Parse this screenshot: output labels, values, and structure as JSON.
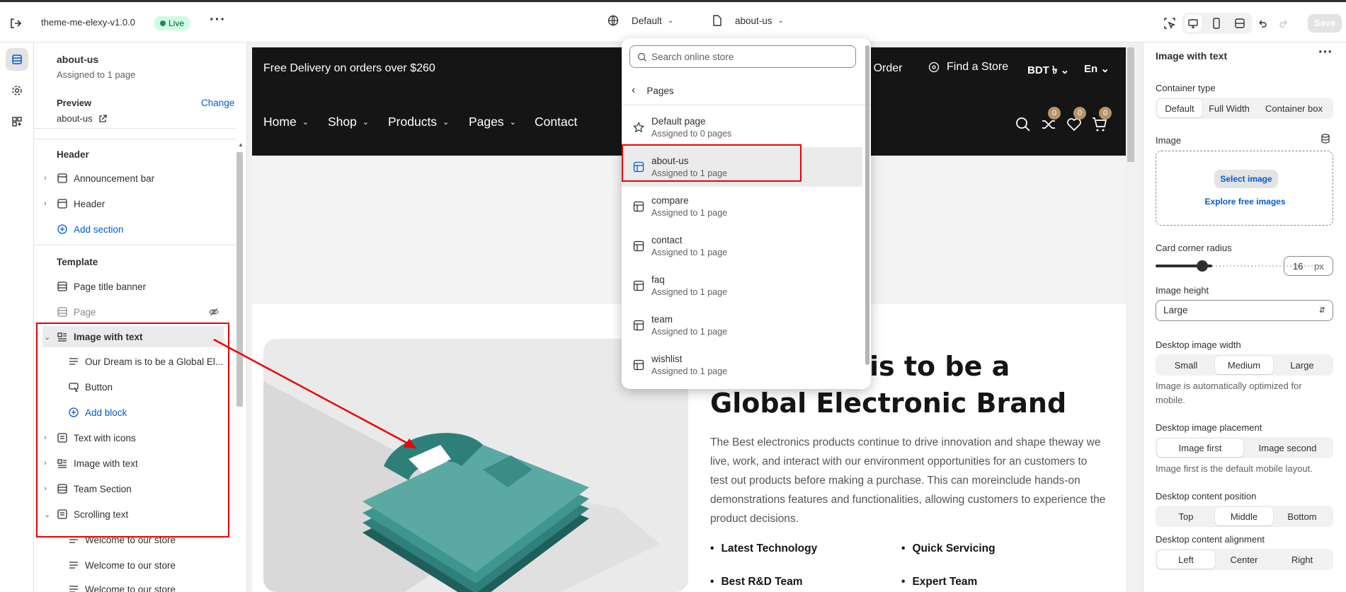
{
  "topbar": {
    "theme_name": "theme-me-elexy-v1.0.0",
    "status_badge": "Live",
    "template_select": "Default",
    "page_select": "about-us",
    "save_label": "Save"
  },
  "left_panel": {
    "page_title": "about-us",
    "page_assigned": "Assigned to 1 page",
    "preview_label": "Preview",
    "change_label": "Change",
    "preview_value": "about-us",
    "header_section": {
      "title": "Header",
      "items": [
        "Announcement bar",
        "Header"
      ],
      "add_section": "Add section"
    },
    "template_section": {
      "title": "Template",
      "items": [
        "Page title banner",
        "Page",
        "Image with text",
        "Our Dream is to be a Global El...",
        "Button",
        "Add block",
        "Text with icons",
        "Image with text",
        "Team Section",
        "Scrolling text",
        "Welcome to our store",
        "Welcome to our store",
        "Welcome to our store"
      ]
    }
  },
  "canvas": {
    "announcement": "Free Delivery on orders over $260",
    "ann_links": [
      "our Order",
      "Find a Store"
    ],
    "currency": "BDT ৳",
    "language": "En",
    "nav": [
      "Home",
      "Shop",
      "Products",
      "Pages",
      "Contact"
    ],
    "badges": [
      "0",
      "0",
      "0"
    ],
    "heading_line1": "is to be a",
    "heading_line2": "Global Electronic Brand",
    "body": "The Best electronics products continue to drive innovation and shape theway we live, work, and interact with our environment opportunities for an customers to test out products before making a purchase. This can moreinclude hands-on demonstrations features and functionalities, allowing customers to experience the product decisions.",
    "bullets": [
      "Latest Technology",
      "Quick Servicing",
      "Best R&D Team",
      "Expert Team"
    ]
  },
  "dropdown": {
    "search_placeholder": "Search online store",
    "back_label": "Pages",
    "items": [
      {
        "name": "Default page",
        "sub": "Assigned to 0 pages"
      },
      {
        "name": "about-us",
        "sub": "Assigned to 1 page"
      },
      {
        "name": "compare",
        "sub": "Assigned to 1 page"
      },
      {
        "name": "contact",
        "sub": "Assigned to 1 page"
      },
      {
        "name": "faq",
        "sub": "Assigned to 1 page"
      },
      {
        "name": "team",
        "sub": "Assigned to 1 page"
      },
      {
        "name": "wishlist",
        "sub": "Assigned to 1 page"
      }
    ]
  },
  "right_panel": {
    "title": "Image with text",
    "container_type_label": "Container type",
    "container_options": [
      "Default",
      "Full Width",
      "Container box"
    ],
    "image_label": "Image",
    "select_image": "Select image",
    "explore_images": "Explore free images",
    "corner_radius_label": "Card corner radius",
    "corner_radius_value": "16",
    "corner_radius_unit": "px",
    "image_height_label": "Image height",
    "image_height_value": "Large",
    "desktop_width_label": "Desktop image width",
    "width_options": [
      "Small",
      "Medium",
      "Large"
    ],
    "width_help": "Image is automatically optimized for mobile.",
    "placement_label": "Desktop image placement",
    "placement_options": [
      "Image first",
      "Image second"
    ],
    "placement_help": "Image first is the default mobile layout.",
    "content_position_label": "Desktop content position",
    "position_options": [
      "Top",
      "Middle",
      "Bottom"
    ],
    "alignment_label": "Desktop content alignment",
    "alignment_options": [
      "Left",
      "Center",
      "Right"
    ]
  },
  "colors": {
    "accent": "#005bd3",
    "highlight": "#e00000",
    "dark": "#151515",
    "teal": "#5aa9a3"
  }
}
